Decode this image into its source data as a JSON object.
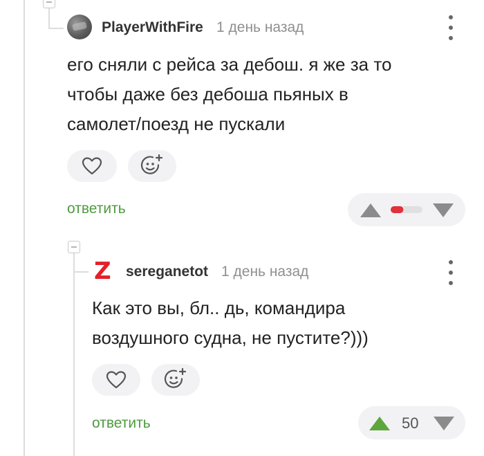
{
  "comments": [
    {
      "username": "PlayerWithFire",
      "time": "1 день назад",
      "lines": [
        "его сняли с рейса за дебош. я же за то",
        "чтобы даже без дебоша пьяных в",
        "самолет/поезд не пускали"
      ],
      "reply_label": "ответить",
      "rating": {
        "fraction_positive": 0.4,
        "negative_color": "#e0e0e0",
        "positive_color": "#e0313c"
      },
      "avatar_icon": "avatar-photo",
      "actions": [
        "heart-icon",
        "add-emoji-icon"
      ]
    },
    {
      "username": "sereganetot",
      "time": "1 день назад",
      "avatar_letter": "Z",
      "lines": [
        "Как это вы, бл.. дь, командира",
        "воздушного судна, не пустите?)))"
      ],
      "reply_label": "ответить",
      "score": "50",
      "actions": [
        "heart-icon",
        "add-emoji-icon"
      ]
    }
  ],
  "colors": {
    "reply_green": "#4f9a3e",
    "upvote_green": "#5da63d",
    "arrow_gray": "#8b8b8b",
    "pill_bg": "#f2f2f4",
    "avatar_red": "#e4202a"
  }
}
